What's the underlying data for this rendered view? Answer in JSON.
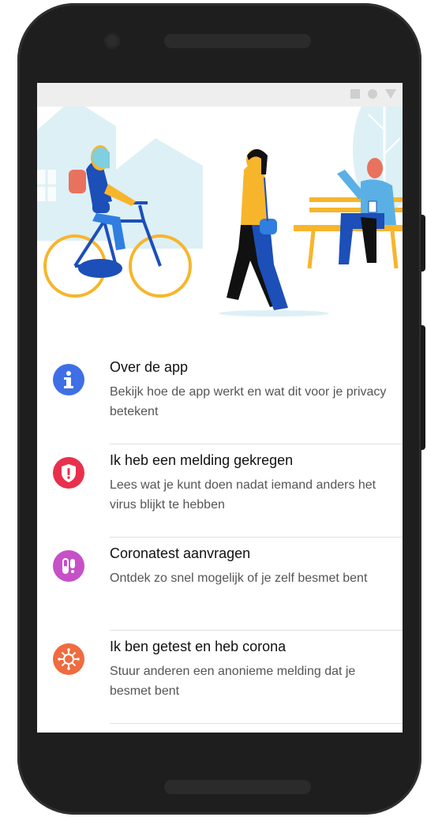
{
  "menu": {
    "items": [
      {
        "title": "Over de app",
        "description": "Bekijk hoe de app werkt en wat dit voor je privacy betekent",
        "icon": "info-icon",
        "color": "#3E6FE6"
      },
      {
        "title": "Ik heb een melding gekregen",
        "description": "Lees wat je kunt doen nadat iemand anders het virus blijkt te hebben",
        "icon": "alert-shield-icon",
        "color": "#E8304D"
      },
      {
        "title": "Coronatest aanvragen",
        "description": "Ontdek zo snel mogelijk of je zelf besmet bent",
        "icon": "test-tubes-icon",
        "color": "#C650C8"
      },
      {
        "title": "Ik ben getest en heb corona",
        "description": "Stuur anderen een anonieme melding dat je besmet bent",
        "icon": "virus-icon",
        "color": "#EF6B40"
      }
    ]
  },
  "colors": {
    "accent_yellow": "#F7B52C",
    "accent_blue": "#1C4FB8",
    "hero_bg": "#DDF0F5"
  }
}
